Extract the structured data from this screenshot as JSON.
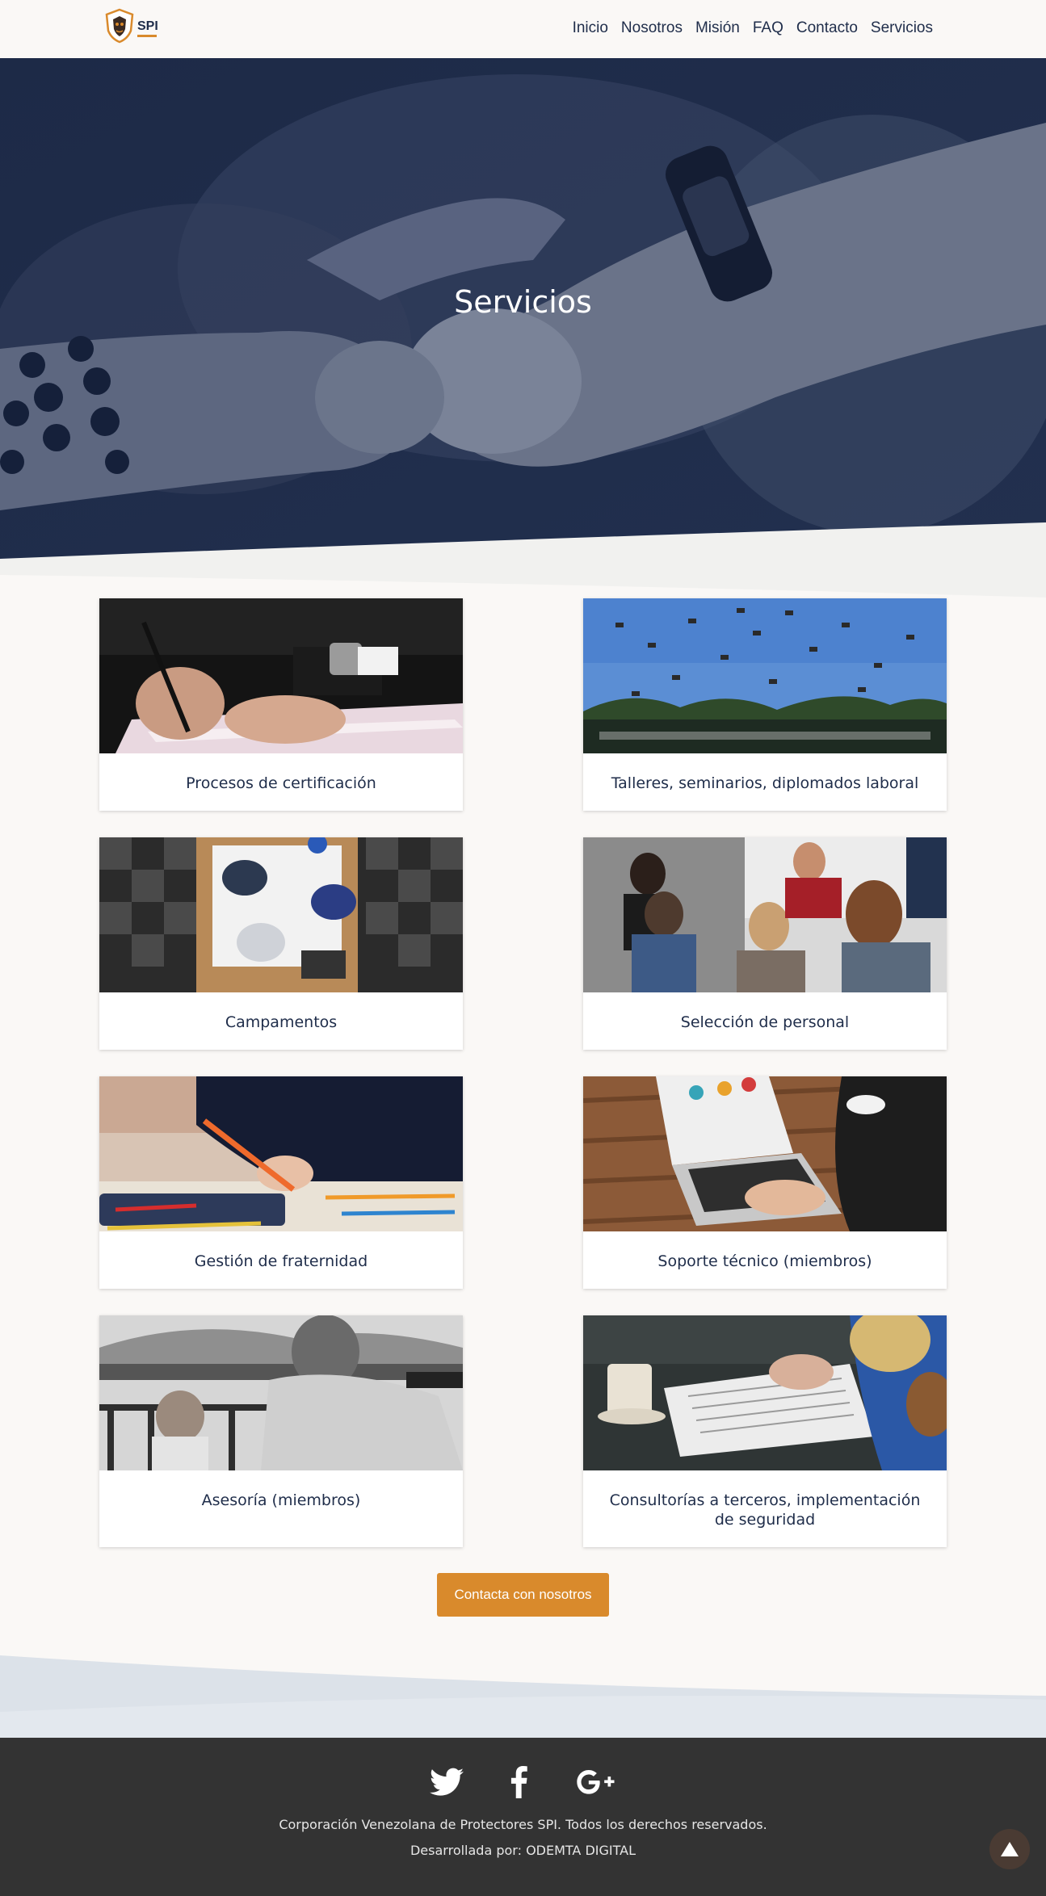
{
  "header": {
    "logo_text": "SPI",
    "nav": [
      "Inicio",
      "Nosotros",
      "Misión",
      "FAQ",
      "Contacto",
      "Servicios"
    ]
  },
  "hero": {
    "title": "Servicios"
  },
  "services": [
    {
      "label": "Procesos de certificación",
      "image": "signing-document-photo"
    },
    {
      "label": "Talleres, seminarios, diplomados laboral",
      "image": "graduation-caps-photo"
    },
    {
      "label": "Campamentos",
      "image": "meeting-table-photo"
    },
    {
      "label": "Selección de personal",
      "image": "group-discussion-photo"
    },
    {
      "label": "Gestión de fraternidad",
      "image": "drawing-pencils-photo"
    },
    {
      "label": "Soporte técnico (miembros)",
      "image": "laptop-typing-photo"
    },
    {
      "label": "Asesoría (miembros)",
      "image": "father-daughter-photo"
    },
    {
      "label": "Consultorías a terceros, implementación de seguridad",
      "image": "notebook-coffee-photo"
    }
  ],
  "cta": {
    "label": "Contacta con nosotros"
  },
  "footer": {
    "social_icons": [
      "twitter-icon",
      "facebook-icon",
      "google-plus-icon"
    ],
    "copyright": "Corporación Venezolana de Protectores SPI. Todos los derechos reservados.",
    "developer": "Desarrollada por: ODEMTA DIGITAL"
  },
  "colors": {
    "navy": "#1f2d4a",
    "accent": "#d98a2c",
    "footer": "#333333",
    "background": "#faf8f6"
  }
}
